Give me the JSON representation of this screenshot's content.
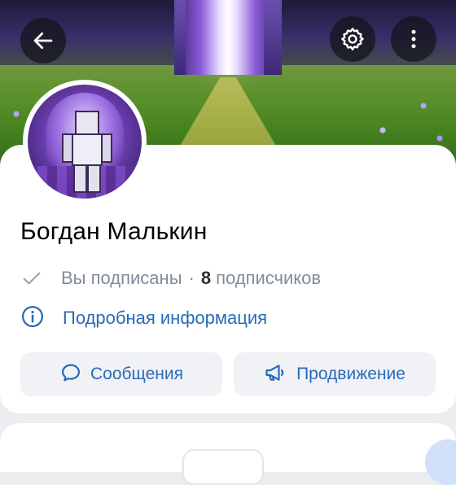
{
  "profile": {
    "name": "Богдан Малькин",
    "subscribed_status": "Вы подписаны",
    "separator": "·",
    "subscribers_count": "8",
    "subscribers_label": "подписчиков",
    "details_link": "Подробная информация"
  },
  "actions": {
    "messages_label": "Сообщения",
    "promote_label": "Продвижение"
  },
  "icons": {
    "back": "arrow-left-icon",
    "settings": "gear-icon",
    "more": "more-vertical-icon",
    "subscribed": "check-icon",
    "info": "info-circle-icon",
    "messages": "speech-bubble-icon",
    "promote": "megaphone-icon"
  },
  "colors": {
    "accent": "#2a6ab8",
    "secondary_text": "#818c99",
    "button_bg": "#f0f2f5"
  }
}
